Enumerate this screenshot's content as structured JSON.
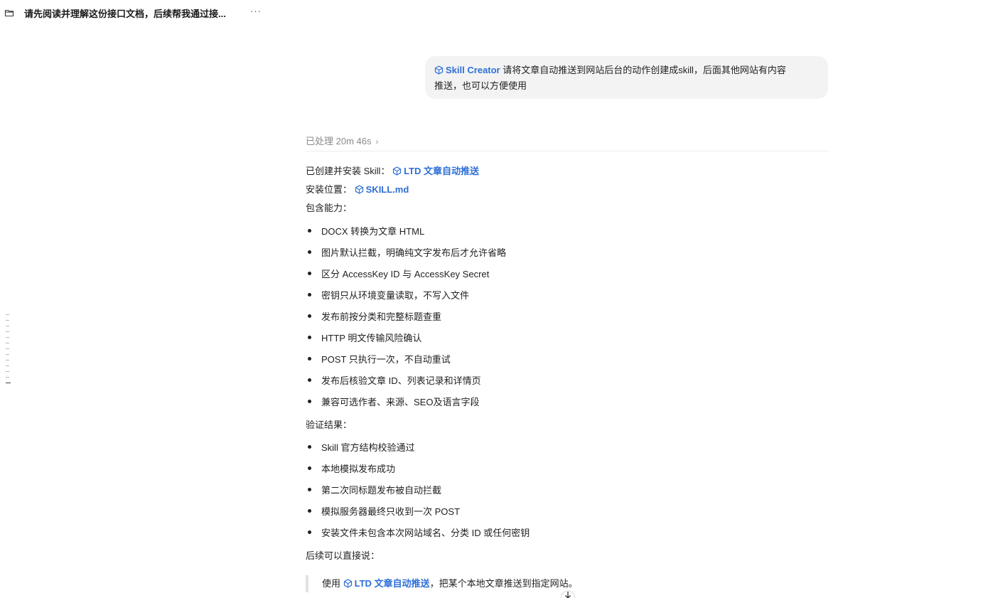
{
  "header": {
    "title": "请先阅读并理解这份接口文档，后续帮我通过接...",
    "more_label": "···"
  },
  "user_message": {
    "skill_name": "Skill Creator",
    "text_line1": "请将文章自动推送到网站后台的动作创建成skill，后面其他网站有内容",
    "text_line2": "推送，也可以方便使用"
  },
  "processed": {
    "label": "已处理 20m 46s",
    "chevron": "›"
  },
  "response": {
    "created_label": "已创建并安装 Skill：",
    "created_skill": "LTD 文章自动推送",
    "location_label": "安装位置：",
    "location_file": "SKILL.md",
    "capabilities_heading": "包含能力：",
    "capabilities": [
      "DOCX 转换为文章 HTML",
      "图片默认拦截，明确纯文字发布后才允许省略",
      "区分 AccessKey ID 与 AccessKey Secret",
      "密钥只从环境变量读取，不写入文件",
      "发布前按分类和完整标题查重",
      "HTTP 明文传输风险确认",
      "POST 只执行一次，不自动重试",
      "发布后核验文章 ID、列表记录和详情页",
      "兼容可选作者、来源、SEO及语言字段"
    ],
    "verification_heading": "验证结果：",
    "verification": [
      "Skill 官方结构校验通过",
      "本地模拟发布成功",
      "第二次同标题发布被自动拦截",
      "模拟服务器最终只收到一次 POST",
      "安装文件未包含本次网站域名、分类 ID 或任何密钥"
    ],
    "followup_heading": "后续可以直接说：",
    "quote_prefix": "使用",
    "quote_skill": "LTD 文章自动推送",
    "quote_suffix": "，把某个本地文章推送到指定网站。"
  },
  "colors": {
    "link": "#2d6fd6",
    "bubble": "#f3f3f3"
  }
}
